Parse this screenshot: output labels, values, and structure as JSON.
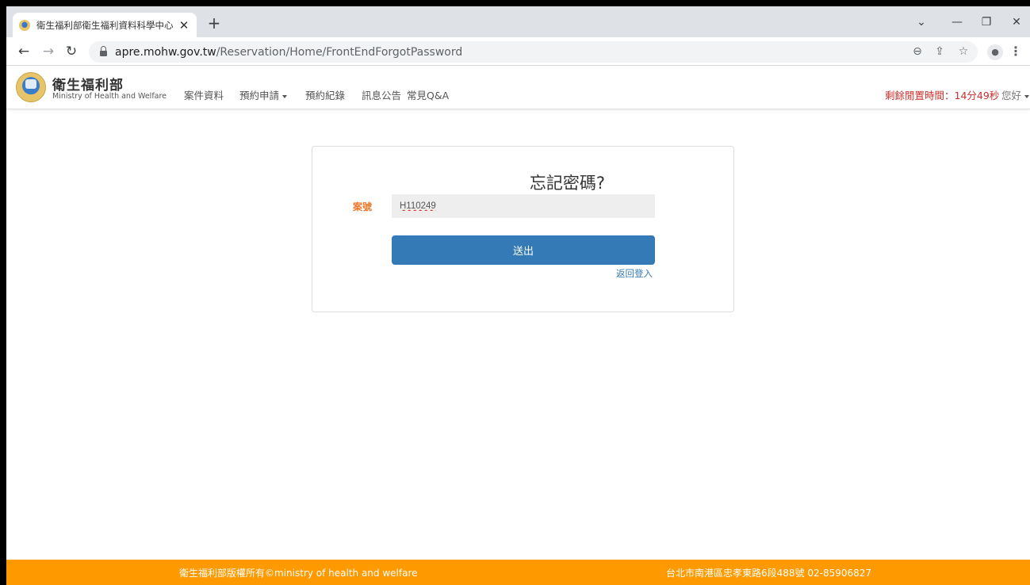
{
  "browser": {
    "tab_title": "衛生福利部衛生福利資料科學中心",
    "tab_close": "✕",
    "new_tab": "+",
    "url_host": "apre.mohw.gov.tw",
    "url_path": "/Reservation/Home/FrontEndForgotPassword",
    "icons": [
      "back-icon",
      "forward-icon",
      "reload-icon",
      "lock-icon",
      "zoom-icon",
      "share-icon",
      "star-icon",
      "profile-icon",
      "menu-icon"
    ]
  },
  "site": {
    "brand_cn": "衛生福利部",
    "brand_en": "Ministry of Health and Welfare",
    "nav": {
      "cases": "案件資料",
      "apply": "預約申請",
      "records": "預約紀錄",
      "news": "訊息公告",
      "faq": "常見Q&A"
    },
    "idle_timer": "剩餘閒置時間：14分49秒",
    "greeting": "您好"
  },
  "form": {
    "title": "忘記密碼?",
    "label": "案號",
    "value": "H110249",
    "submit": "送出",
    "back_link": "返回登入"
  },
  "footer": {
    "copyright": "衛生福利部版權所有©ministry of health and welfare",
    "address": "台北市南港區忠孝東路6段488號 02-85906827"
  },
  "colors": {
    "primary": "#337ab7",
    "footer": "#ff9900",
    "timer": "#c9302c",
    "label": "#e8782b"
  }
}
